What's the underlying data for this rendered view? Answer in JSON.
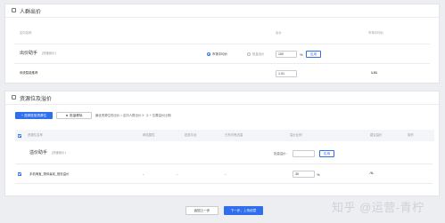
{
  "bid_panel": {
    "title": "人群出价",
    "headers": {
      "name": "定向名称",
      "bid": "出价",
      "suggest": "市场平均价"
    },
    "assistant": {
      "label": "出价助手",
      "hint": "(快速設价)",
      "option_market": "市场平均价",
      "option_batch": "批量出价",
      "percent_value": "100",
      "percent_unit": "%",
      "apply_label": "应用"
    },
    "row": {
      "name": "系统智能推荐",
      "bid": "1.01",
      "suggest": "1.01"
    }
  },
  "resource_panel": {
    "title": "资源位及溢价",
    "select_button": "+ 选择投放资源位",
    "batch_remove": "批量移除",
    "note": "最优资源位的出价 = 定向人群出价 X（1 + 位置溢价比例）",
    "headers": {
      "name": "资源位名称",
      "attr": "网站属性",
      "device": "投放平台",
      "visitors": "已布可竞流量",
      "premium": "溢价比例",
      "suggest": "建议溢价",
      "ops": "操作"
    },
    "assistant": {
      "label": "溢价助手",
      "hint": "(快速設价)",
      "batch_label": "批量溢价：",
      "apply_label": "应用"
    },
    "row": {
      "name": "手机淘宝_猜你喜欢_首页溢价",
      "attr": "-",
      "device": "-",
      "visitors": "-",
      "premium": "30",
      "unit": "%",
      "suggest": "-%"
    }
  },
  "footer": {
    "prev": "返回上一步",
    "next": "下一步，上传创意"
  },
  "watermark": "知乎 @运营-青柠"
}
